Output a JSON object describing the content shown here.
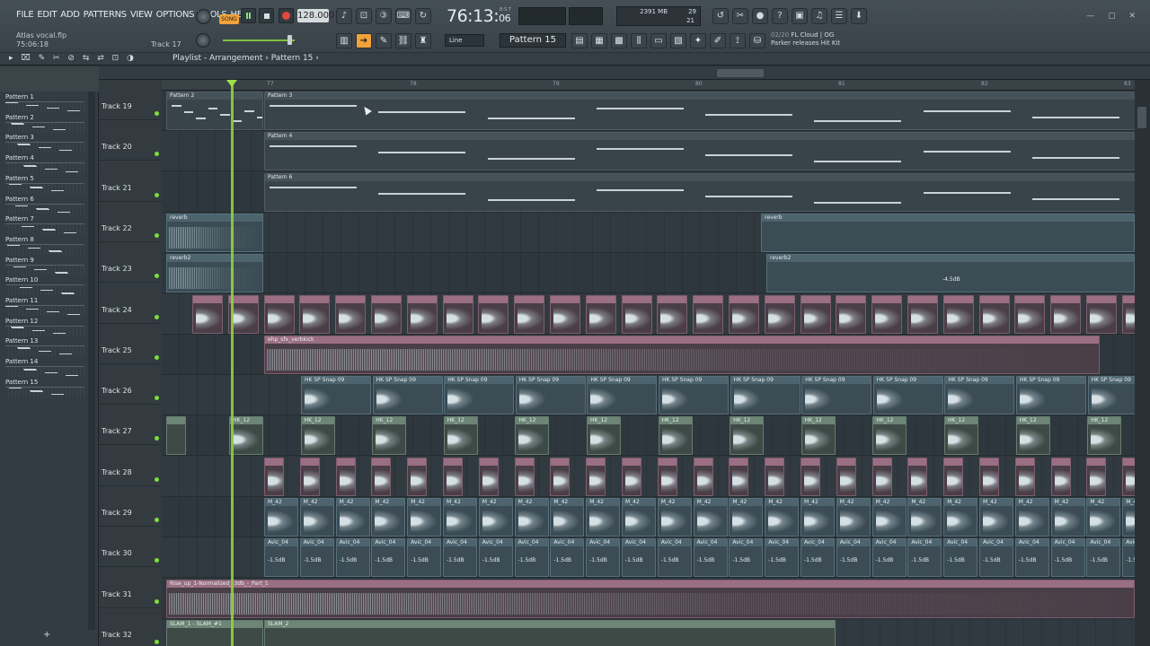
{
  "menu": [
    "FILE",
    "EDIT",
    "ADD",
    "PATTERNS",
    "VIEW",
    "OPTIONS",
    "TOOLS",
    "HELP"
  ],
  "project": {
    "file": "Atlas vocal.flp",
    "time": "75:06:18",
    "track": "Track 17"
  },
  "transport": {
    "mode": "SONG",
    "tempo": "128.000",
    "time": "76:13",
    "time_small": "06",
    "bst": "B:S:T"
  },
  "cpu": {
    "mem": "2391 MB",
    "cores": "29",
    "poly": "21"
  },
  "snap": "Line",
  "pattern_selector": "Pattern 15",
  "news": {
    "count": "02/20",
    "source": "FL Cloud | OG",
    "headline": "Parker releases Hit Kit"
  },
  "playlist": {
    "title": "Playlist - Arrangement",
    "pattern": "Pattern 15"
  },
  "ruler": [
    "77",
    "78",
    "79",
    "80",
    "81",
    "82",
    "83"
  ],
  "patterns": [
    "Pattern 1",
    "Pattern 2",
    "Pattern 3",
    "Pattern 4",
    "Pattern 5",
    "Pattern 6",
    "Pattern 7",
    "Pattern 8",
    "Pattern 9",
    "Pattern 10",
    "Pattern 11",
    "Pattern 12",
    "Pattern 13",
    "Pattern 14",
    "Pattern 15"
  ],
  "tracks": [
    "Track 19",
    "Track 20",
    "Track 21",
    "Track 22",
    "Track 23",
    "Track 24",
    "Track 25",
    "Track 26",
    "Track 27",
    "Track 28",
    "Track 29",
    "Track 30",
    "Track 31",
    "Track 32"
  ],
  "clips": {
    "p2": "Pattern 2",
    "p3": "Pattern 3",
    "p4": "Pattern 4",
    "p6": "Pattern 6",
    "reverb": "reverb",
    "reverb2": "reverb2",
    "vol_label": "-4.5dB",
    "verbkick": "ehp_sfx_verbkick",
    "snap": "HK SP Snap 09",
    "hk12": "HK_12",
    "m42": "M_42",
    "avic": "Avic_04",
    "db": "-1.5dB",
    "rise": "Rise_up_1-Normalized_-3db_-_Part_1",
    "slam1": "SLAM_1 - SLAM_#1",
    "slam2": "SLAM_2"
  },
  "colors": {
    "playhead": "#8fd43a",
    "accent": "#f1a23a"
  }
}
